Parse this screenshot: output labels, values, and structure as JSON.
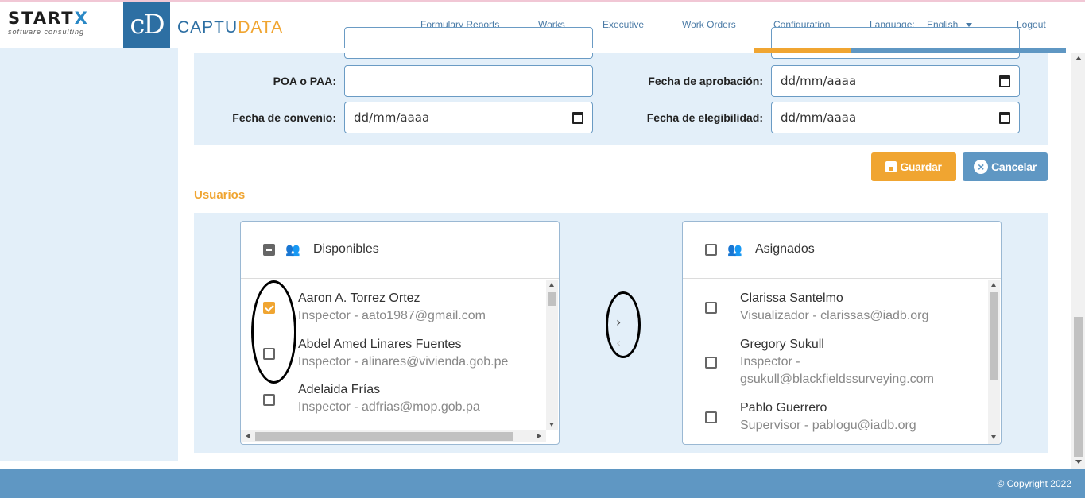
{
  "header": {
    "startx_word_main": "START",
    "startx_word_x": "X",
    "startx_tagline": "software consulting",
    "cd_logo_text": "cD",
    "brand_part1": "CAPTU",
    "brand_part2": "DATA",
    "nav": {
      "formulary_reports": "Formulary Reports",
      "works": "Works",
      "executive": "Executive",
      "work_orders": "Work Orders",
      "configuration": "Configuration",
      "language_label": "Language:",
      "language_value": "English",
      "logout": "Logout"
    },
    "active_nav": "Configuration"
  },
  "form": {
    "poa_label": "POA o PAA:",
    "poa_value": "",
    "fecha_aprobacion_label": "Fecha de aprobación:",
    "fecha_aprobacion_value": "dd/mm/aaaa",
    "fecha_convenio_label": "Fecha de convenio:",
    "fecha_convenio_value": "dd/mm/aaaa",
    "fecha_elegibilidad_label": "Fecha de elegibilidad:",
    "fecha_elegibilidad_value": "dd/mm/aaaa"
  },
  "actions": {
    "save_label": "Guardar",
    "cancel_label": "Cancelar"
  },
  "users": {
    "section_title": "Usuarios",
    "available": {
      "title": "Disponibles",
      "select_all_state": "indeterminate",
      "items": [
        {
          "name": "Aaron A. Torrez Ortez",
          "detail": "Inspector - aato1987@gmail.com",
          "checked": true
        },
        {
          "name": "Abdel Amed Linares Fuentes",
          "detail": "Inspector - alinares@vivienda.gob.pe",
          "checked": false
        },
        {
          "name": "Adelaida Frías",
          "detail": "Inspector - adfrias@mop.gob.pa",
          "checked": false
        }
      ]
    },
    "assigned": {
      "title": "Asignados",
      "select_all_state": "unchecked",
      "items": [
        {
          "name": "Clarissa Santelmo",
          "detail": "Visualizador - clarissas@iadb.org",
          "checked": false
        },
        {
          "name": "Gregory Sukull",
          "detail_line1": "Inspector -",
          "detail_line2": "gsukull@blackfieldssurveying.com",
          "checked": false
        },
        {
          "name": "Pablo Guerrero",
          "detail": "Supervisor - pablogu@iadb.org",
          "checked": false
        }
      ]
    },
    "move_right_glyph": "›",
    "move_left_glyph": "‹"
  },
  "footer": {
    "copyright": "© Copyright 2022"
  },
  "colors": {
    "accent_orange": "#f0a531",
    "accent_blue": "#5f97c3",
    "panel_bg": "#e3eff9",
    "brand_blue": "#2d6fa3"
  },
  "icons": {
    "save": "floppy-disk-icon",
    "cancel": "x-circle-icon",
    "calendar": "calendar-icon",
    "people_outline": "people-outline-icon",
    "people_filled": "people-filled-icon"
  }
}
